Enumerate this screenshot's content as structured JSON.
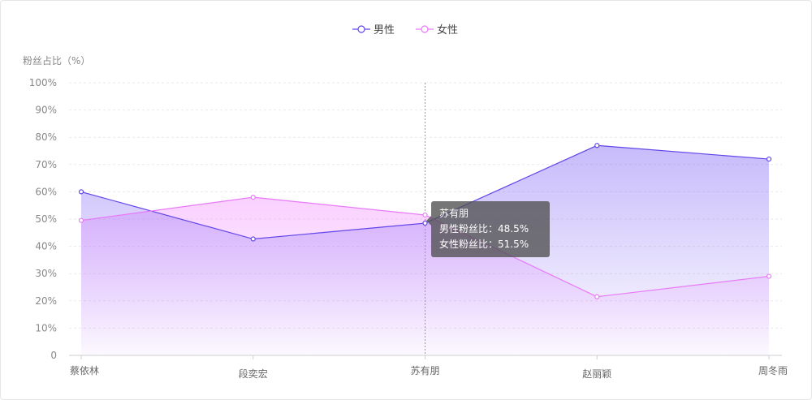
{
  "chart_data": {
    "type": "area",
    "ylabel": "粉丝占比（%）",
    "categories": [
      "蔡依林",
      "段奕宏",
      "苏有朋",
      "赵丽颖",
      "周冬雨"
    ],
    "ylim": [
      0,
      100
    ],
    "yticks": [
      "0",
      "10%",
      "20%",
      "30%",
      "40%",
      "50%",
      "60%",
      "70%",
      "80%",
      "90%",
      "100%"
    ],
    "grid": true,
    "legend_position": "top-center",
    "series": [
      {
        "name": "男性",
        "values": [
          60,
          42.7,
          48.5,
          77,
          72
        ],
        "color": "#6246ea"
      },
      {
        "name": "女性",
        "values": [
          49.5,
          58,
          51.5,
          21.5,
          29
        ],
        "color": "#e879f9"
      }
    ]
  },
  "tooltip": {
    "title": "苏有朋",
    "male_text": "男性粉丝比：48.5%",
    "female_text": "女性粉丝比：51.5%"
  }
}
